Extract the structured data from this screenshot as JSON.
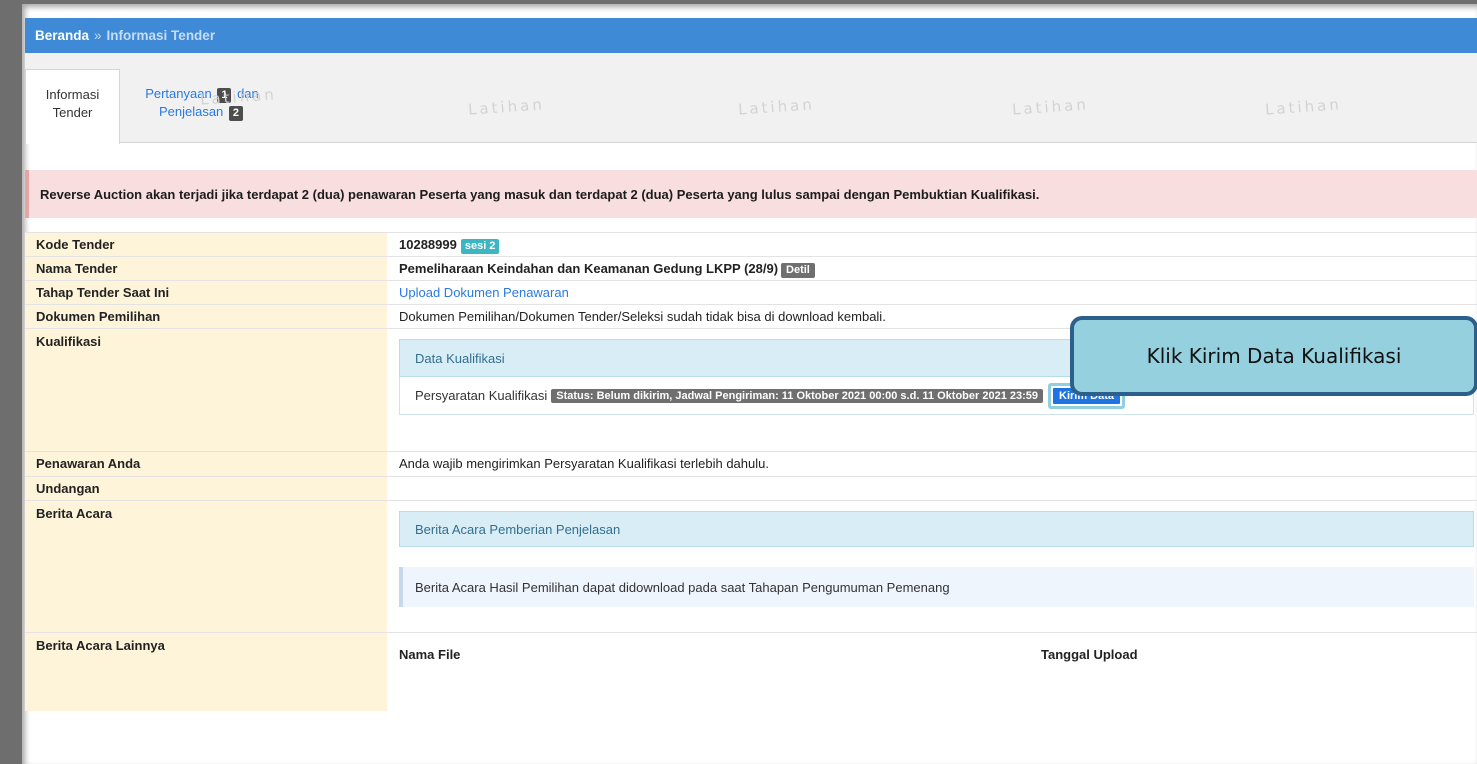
{
  "breadcrumb": {
    "home": "Beranda",
    "separator": "»",
    "current": "Informasi Tender"
  },
  "tabs": {
    "info_line1": "Informasi",
    "info_line2": "Tender",
    "qa_part1": "Pertanyaan",
    "qa_count": "1",
    "qa_and": "dan",
    "qa_part2": "Penjelasan",
    "qa_count2": "2"
  },
  "watermark": "Latihan",
  "alert": "Reverse Auction akan terjadi jika terdapat 2 (dua) penawaran Peserta yang masuk dan terdapat 2 (dua) Peserta yang lulus sampai dengan Pembuktian Kualifikasi.",
  "rows": {
    "kode_label": "Kode Tender",
    "kode_value": "10288999",
    "kode_badge": "sesi 2",
    "nama_label": "Nama Tender",
    "nama_value": "Pemeliharaan Keindahan dan Keamanan Gedung LKPP (28/9)",
    "nama_badge": "Detil",
    "tahap_label": "Tahap Tender Saat Ini",
    "tahap_value": "Upload Dokumen Penawaran",
    "dok_label": "Dokumen Pemilihan",
    "dok_value": "Dokumen Pemilihan/Dokumen Tender/Seleksi sudah tidak bisa di download kembali.",
    "kual_label": "Kualifikasi",
    "kual_panel": "Data Kualifikasi",
    "kual_item": "Persyaratan Kualifikasi",
    "kual_status": "Status: Belum dikirim, Jadwal Pengiriman: 11 Oktober 2021 00:00 s.d. 11 Oktober 2021 23:59",
    "kual_button": "Kirim Data",
    "penawaran_label": "Penawaran Anda",
    "penawaran_value": "Anda wajib mengirimkan Persyaratan Kualifikasi terlebih dahulu.",
    "undangan_label": "Undangan",
    "ba_label": "Berita Acara",
    "ba_panel": "Berita Acara Pemberian Penjelasan",
    "ba_note": "Berita Acara Hasil Pemilihan dapat didownload pada saat Tahapan Pengumuman Pemenang",
    "bal_label": "Berita Acara Lainnya",
    "col_file": "Nama File",
    "col_date": "Tanggal Upload"
  },
  "callout": "Klik Kirim Data Kualifikasi",
  "colors": {
    "topbar": "#3e8ad6",
    "label_bg": "#fdf4d9",
    "alert_bg": "#f8dede",
    "callout": "#95d0de",
    "button": "#1e74e0"
  }
}
